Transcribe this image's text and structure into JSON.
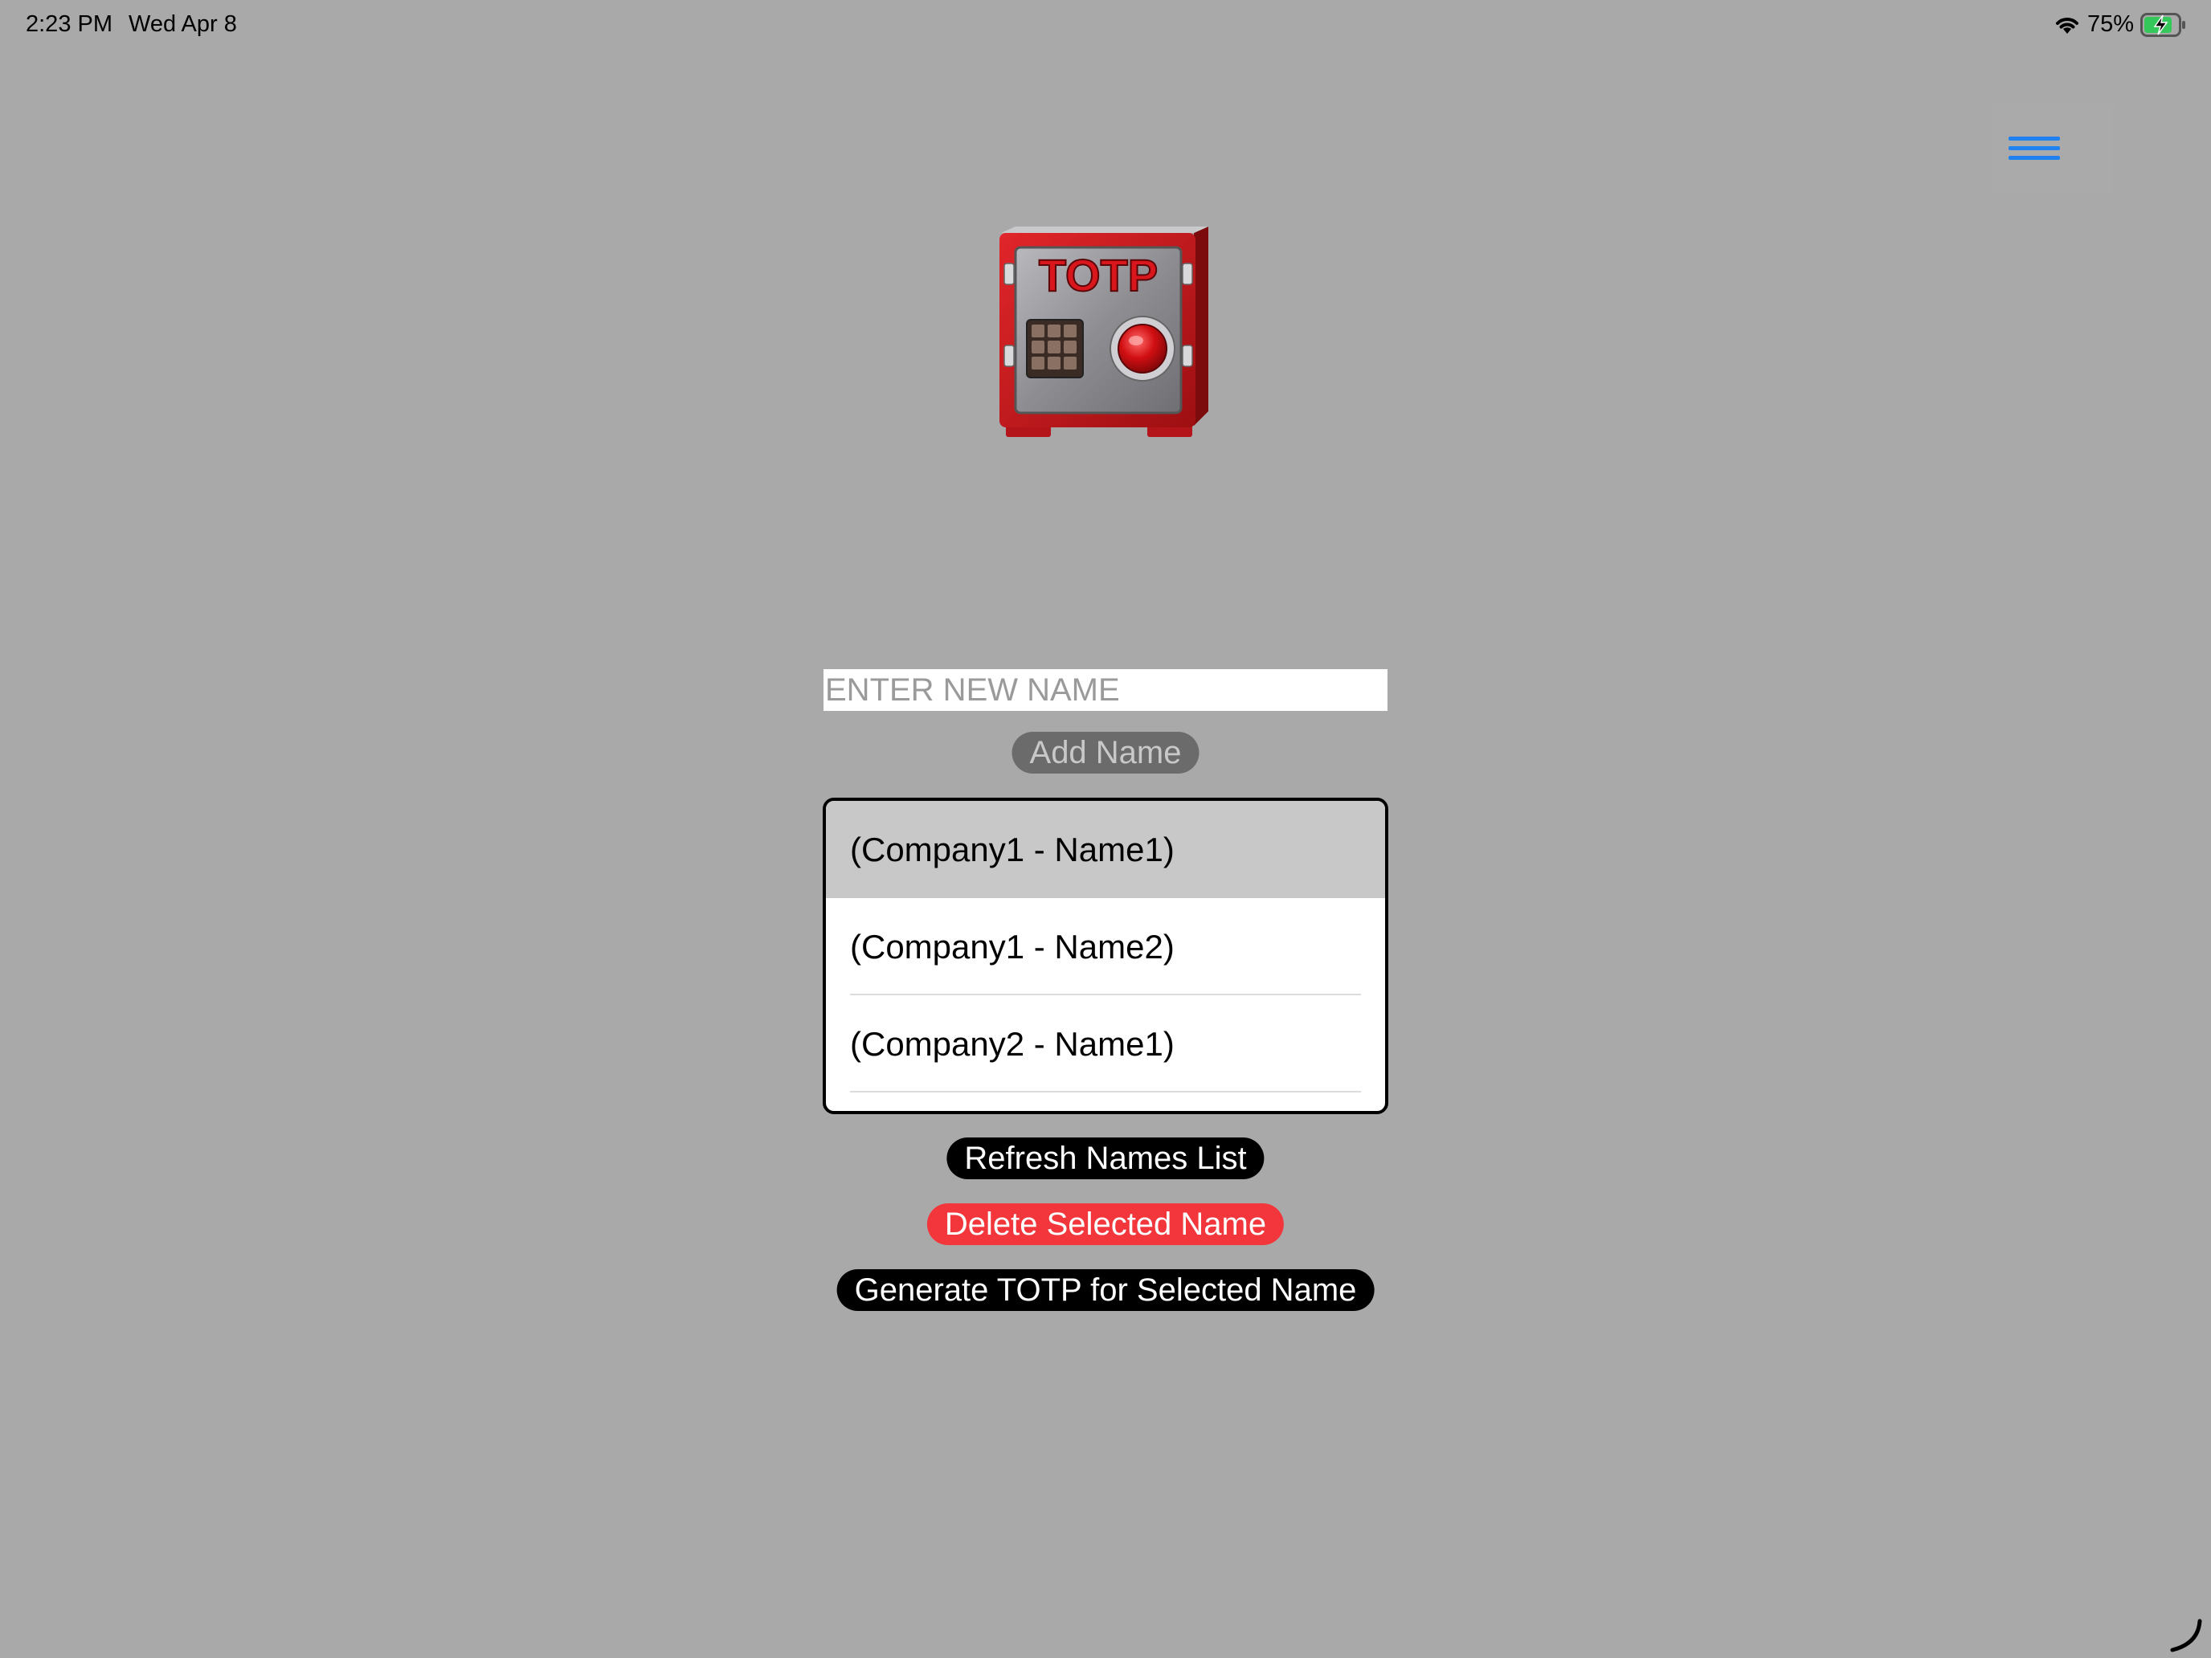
{
  "status_bar": {
    "time": "2:23 PM",
    "date": "Wed Apr 8",
    "battery": "75%"
  },
  "logo": {
    "text": "TOTP"
  },
  "name_input": {
    "placeholder": "ENTER NEW NAME",
    "value": ""
  },
  "buttons": {
    "add": "Add Name",
    "refresh": "Refresh Names List",
    "delete": "Delete Selected Name",
    "generate": "Generate TOTP for Selected Name"
  },
  "names_list": {
    "items": [
      {
        "label": "(Company1 - Name1)",
        "selected": true
      },
      {
        "label": "(Company1 - Name2)",
        "selected": false
      },
      {
        "label": "(Company2 - Name1)",
        "selected": false
      }
    ]
  },
  "colors": {
    "background": "#a9a9a9",
    "menu_accent": "#1f82f0",
    "delete_red": "#f2363b",
    "selected_row": "#c8c8c8"
  },
  "icons": {
    "menu": "hamburger-menu-icon",
    "wifi": "wifi-icon",
    "battery": "battery-charging-icon",
    "logo": "safe-icon"
  }
}
